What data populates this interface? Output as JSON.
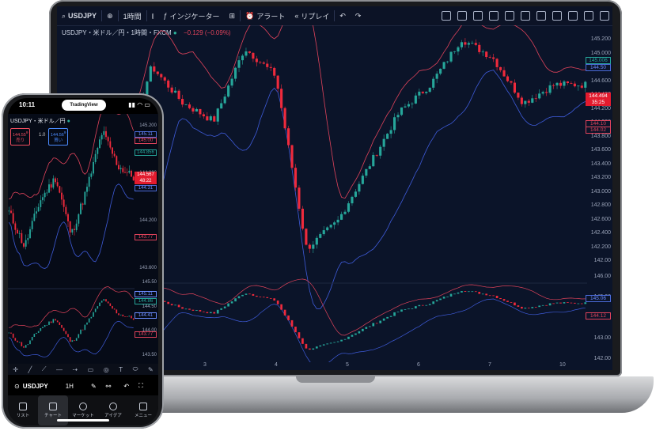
{
  "laptop": {
    "toolbar": {
      "symbol": "USDJPY",
      "add": "⊕",
      "interval": "1時間",
      "indicators": "インジケーター",
      "alert": "アラート",
      "replay": "リプレイ"
    },
    "legend": {
      "title": "USDJPY・米ドル／円・1時間・FXCM",
      "change": "−0.129 (−0.09%)"
    },
    "price_ticks": [
      "145.200",
      "145.000",
      "144.800",
      "144.600",
      "144.400",
      "144.200",
      "144.000",
      "143.800",
      "143.600",
      "143.400",
      "143.200",
      "143.000",
      "142.800",
      "142.600",
      "142.400",
      "142.200",
      "142.00"
    ],
    "price_tags": {
      "upper": "145.006",
      "mid": "144.50",
      "last": "144.494",
      "countdown": "35:25",
      "lower1": "144.10",
      "lower2": "144.02"
    },
    "lower_ticks": [
      "146.00",
      "145.00",
      "144.00",
      "143.00",
      "142.00"
    ],
    "lower_tags": {
      "upper": "145.06",
      "lower": "144.12"
    },
    "time_ticks": [
      "3",
      "4",
      "5",
      "6",
      "7",
      "10"
    ]
  },
  "phone": {
    "status": {
      "time": "10:11",
      "island": "TradingView"
    },
    "legend": {
      "title": "USDJPY・米ドル／円"
    },
    "sell": {
      "price": "144.55",
      "sup": "9",
      "label": "売り"
    },
    "spread": "1.0",
    "buy": {
      "price": "144.56",
      "sup": "9",
      "label": "買い"
    },
    "price_ticks": [
      "145.200",
      "144.800",
      "144.200",
      "143.600"
    ],
    "price_tags": {
      "t1": "145.11",
      "t2": "145.00",
      "t3": "144.856",
      "last": "144.567",
      "countdown": "48:22",
      "t5": "144.31",
      "t6": "143.77"
    },
    "lower_ticks": [
      "145.50",
      "144.50",
      "144.00",
      "143.50"
    ],
    "lower_tags": {
      "t1": "145.11",
      "t2": "144.86",
      "t3": "144.41",
      "t4": "143.77"
    },
    "bottom_bar": {
      "symbol": "USDJPY",
      "interval": "1H"
    },
    "tabs": [
      "リスト",
      "チャート",
      "マーケット",
      "アイデア",
      "メニュー"
    ]
  },
  "colors": {
    "bg": "#0b1429",
    "up": "#26a69a",
    "down": "#ef2a3c",
    "upper_band": "#e0435b",
    "lower_band": "#3e5bd9"
  }
}
